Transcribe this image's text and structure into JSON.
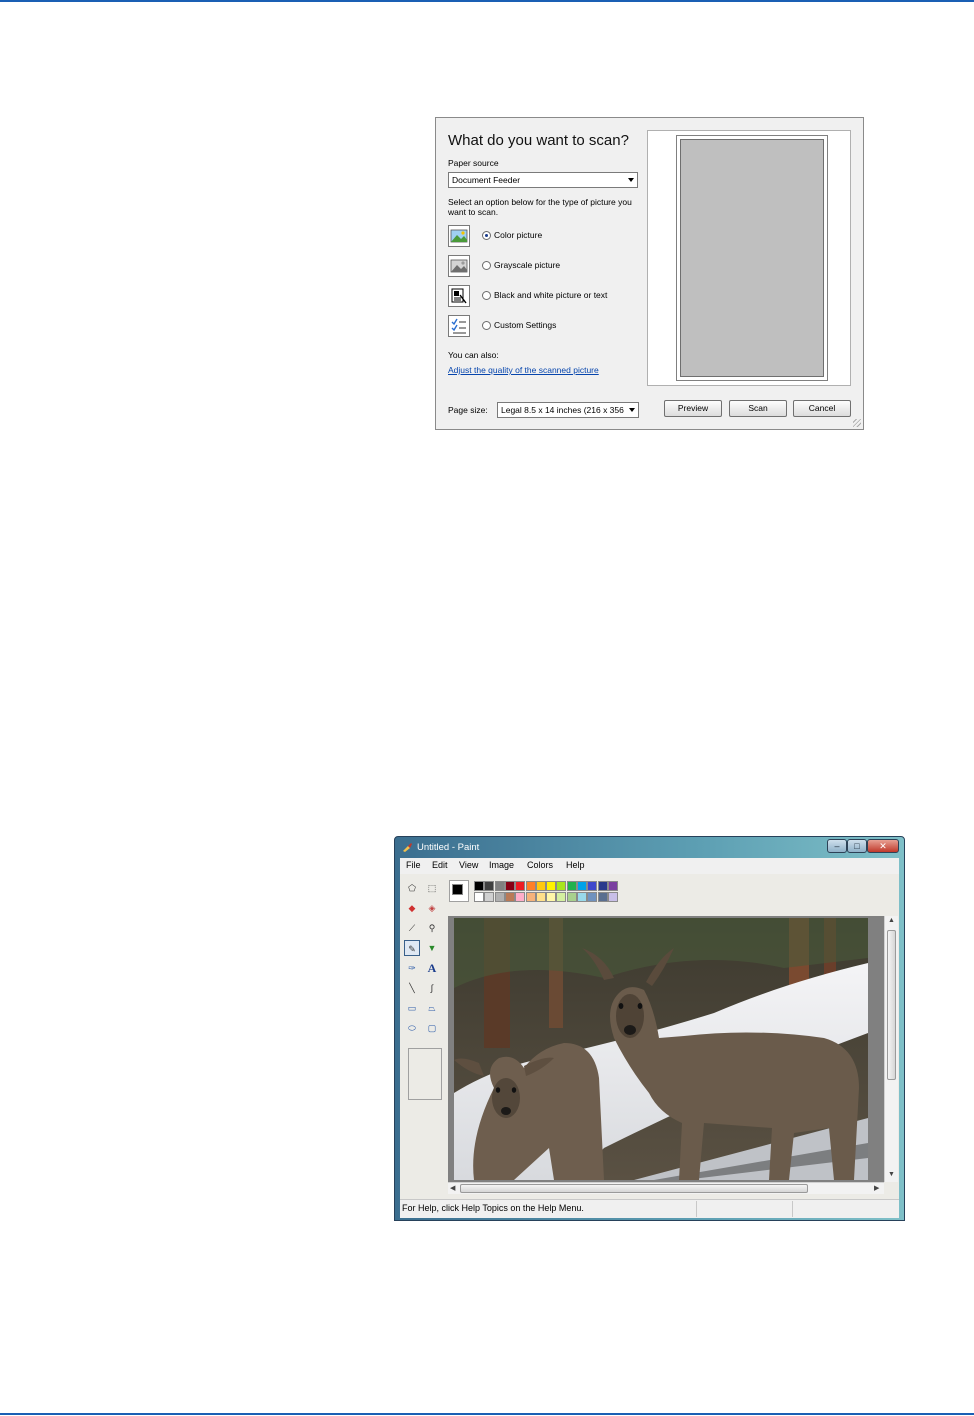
{
  "scan_dialog": {
    "title": "What do you want to scan?",
    "paper_source_label": "Paper source",
    "paper_source_value": "Document Feeder",
    "instruction": "Select an option below for the type of picture you want to scan.",
    "options": [
      {
        "label": "Color picture",
        "icon": "color-picture-icon",
        "selected": true
      },
      {
        "label": "Grayscale picture",
        "icon": "grayscale-picture-icon",
        "selected": false
      },
      {
        "label": "Black and white picture or text",
        "icon": "black-white-text-icon",
        "selected": false
      },
      {
        "label": "Custom Settings",
        "icon": "custom-settings-icon",
        "selected": false
      }
    ],
    "you_can_also": "You can also:",
    "adjust_link": "Adjust the quality of the scanned picture",
    "page_size_label": "Page size:",
    "page_size_value": "Legal 8.5 x 14 inches (216 x 356",
    "preview_button": "Preview",
    "scan_button": "Scan",
    "cancel_button": "Cancel"
  },
  "paint_window": {
    "title": "Untitled - Paint",
    "menu": [
      "File",
      "Edit",
      "View",
      "Image",
      "Colors",
      "Help"
    ],
    "status_text": "For Help, click Help Topics on the Help Menu.",
    "palette_top": [
      "#000000",
      "#404040",
      "#808080",
      "#880015",
      "#ed1c24",
      "#ff7f27",
      "#ffc90e",
      "#fff200",
      "#a8e61d",
      "#22b14c",
      "#00a2e8",
      "#3f48cc",
      "#2a3a8c",
      "#7a3fa0"
    ],
    "palette_bottom": [
      "#ffffff",
      "#d0d0d0",
      "#b0b0b0",
      "#b97a57",
      "#ffaec9",
      "#f5b27a",
      "#ffe08a",
      "#fff7a8",
      "#d4efa0",
      "#a8d08d",
      "#99d9ea",
      "#7092be",
      "#5a6f90",
      "#c8bfe7"
    ],
    "foreground_color": "#000000",
    "background_color": "#ffffff"
  }
}
